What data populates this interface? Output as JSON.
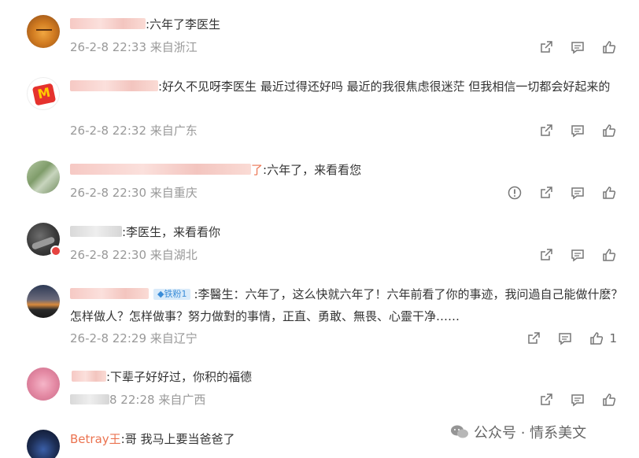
{
  "comments": [
    {
      "text": ":六年了李医生",
      "time": "26-2-8 22:33",
      "location": "来自浙江"
    },
    {
      "text": ":好久不见呀李医生 最近过得还好吗 最近的我很焦虑很迷茫 但我相信一切都会好起来的",
      "time": "26-2-8 22:32",
      "location": "来自广东"
    },
    {
      "name_tail": "了",
      "text": ":六年了，来看看您",
      "time": "26-2-8 22:30",
      "location": "来自重庆"
    },
    {
      "text": ":李医生，来看看你",
      "time": "26-2-8 22:30",
      "location": "来自湖北"
    },
    {
      "badge": "铁粉1",
      "text": ":李醫生：六年了，这么快就六年了！六年前看了你的事迹，我问過自己能做什麽？怎样做人？怎样做事？努力做對的事情，正直、勇敢、無畏、心靈干净……",
      "time": "26-2-8 22:29",
      "location": "来自辽宁",
      "likes": "1"
    },
    {
      "text": ":下辈子好好过，你积的福德",
      "time": "8 22:28",
      "location": "来自广西"
    },
    {
      "username": "Betray王",
      "text": ":哥  我马上要当爸爸了"
    }
  ],
  "watermark": {
    "text": "公众号 · 情系美文"
  },
  "colors": {
    "username": "#eb7350",
    "meta": "#999999",
    "badge_bg": "#d9ebfa",
    "badge_fg": "#3b8dd8"
  },
  "icons": [
    "share-icon",
    "comment-icon",
    "like-icon",
    "report-icon"
  ]
}
